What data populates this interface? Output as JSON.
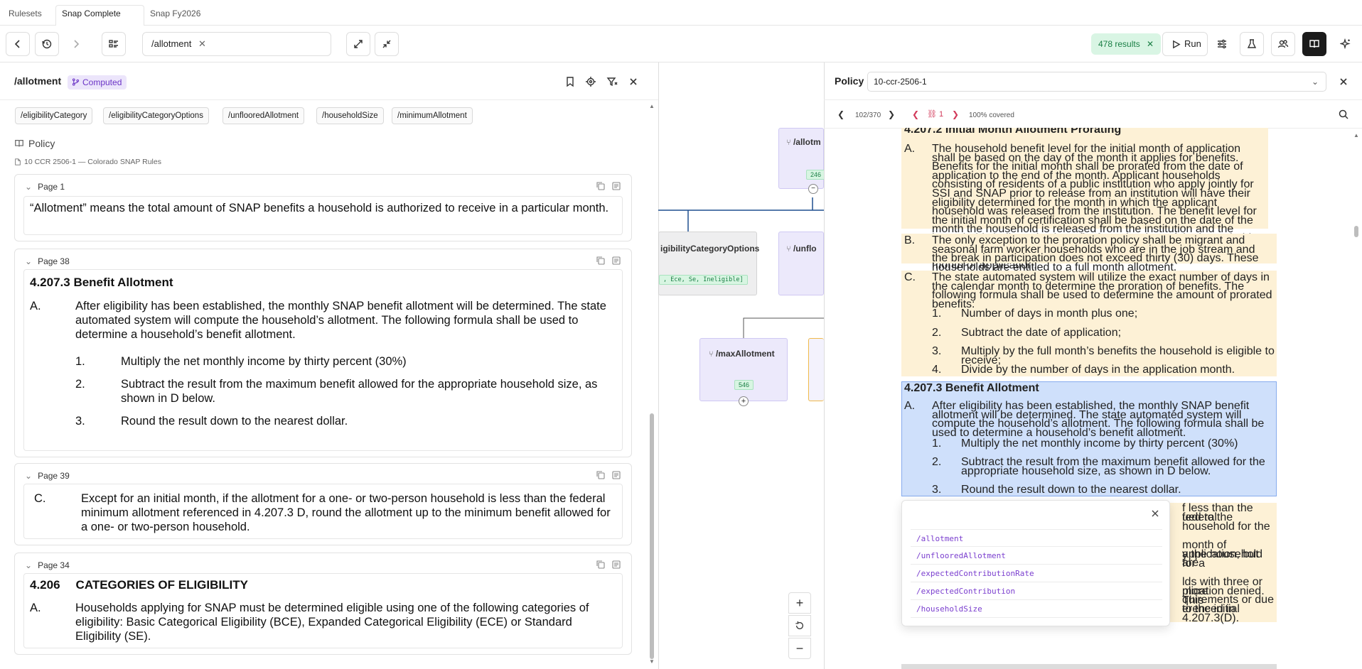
{
  "tabs": [
    {
      "label": "Rulesets"
    },
    {
      "label": "Snap Complete"
    },
    {
      "label": "Snap Fy2026"
    }
  ],
  "toolbar": {
    "path_value": "/allotment",
    "results_label": "478 results",
    "run_label": "Run"
  },
  "left": {
    "title": "/allotment",
    "computed_label": "Computed",
    "chips": [
      "/eligibilityCategory",
      "/eligibilityCategoryOptions",
      "/unflooredAllotment",
      "/householdSize",
      "/minimumAllotment"
    ],
    "policy_heading": "Policy",
    "source_label": "10 CCR 2506-1 — Colorado SNAP Rules",
    "cards": [
      {
        "page": "Page 1",
        "text": "“Allotment” means the total amount of SNAP benefits a household is authorized to receive in a particular month."
      },
      {
        "page": "Page 38",
        "heading": "4.207.3 Benefit Allotment",
        "letter": "A.",
        "para": "After eligibility has been established, the monthly SNAP benefit allotment will be determined. The state automated system will compute the household’s allotment. The following formula shall be used to determine a household’s benefit allotment.",
        "items": [
          {
            "num": "1.",
            "text": "Multiply the net monthly income by thirty percent (30%)"
          },
          {
            "num": "2.",
            "text": "Subtract the result from the maximum benefit allowed for the appropriate household size, as shown in D below."
          },
          {
            "num": "3.",
            "text": "Round the result down to the nearest dollar."
          }
        ]
      },
      {
        "page": "Page 39",
        "letter": "C.",
        "para": "Except for an initial month, if the allotment for a one- or two-person household is less than the federal minimum allotment referenced in 4.207.3 D, round the allotment up to the minimum benefit allowed for a one- or two-person household."
      },
      {
        "page": "Page 34",
        "num": "4.206",
        "heading": "CATEGORIES OF ELIGIBILITY",
        "letter": "A.",
        "para": "Households applying for SNAP must be determined eligible using one of the following categories of eligibility: Basic Categorical Eligibility (BCE), Expanded Categorical Eligibility (ECE) or Standard Eligibility (SE)."
      }
    ]
  },
  "graph": {
    "node_allotment": "/allotm",
    "node_allotment_badge": "246",
    "node_options": "igibilityCategoryOptions",
    "node_options_badge": ", Ece, Se, Ineligible]",
    "node_unfloored": "/unflo",
    "node_max": "/maxAllotment",
    "node_max_badge": "546"
  },
  "policy": {
    "label": "Policy",
    "select_value": "10-ccr-2506-1",
    "page_counter": "102/370",
    "match_counter": "1",
    "coverage": "100% covered",
    "doc": {
      "top_heading": "4.207.2 Initial Month Allotment Prorating",
      "a_letter": "A.",
      "a_text": "The household benefit level for the initial month of application shall be based on the day of the month it applies for benefits. Benefits for the initial month shall be prorated from the date of application to the end of the month. Applicant households consisting of residents of a public institution who apply jointly for SSI and SNAP prior to release from an institution will have their eligibility determined for the month in which the applicant household was released from the institution. The benefit level for the initial month of certification shall be based on the date of the month the household is released from the institution and the household shall receive benefits from the date of the household’s release through the end of the month. Eligible households are entitled to a full month allotment for all months except an initial month of application.",
      "b_letter": "B.",
      "b_text": "The only exception to the proration policy shall be migrant and seasonal farm worker households who are in the job stream and the break in participation does not exceed thirty (30) days. These households are entitled to a full month allotment.",
      "c_letter": "C.",
      "c_text": "The state automated system will utilize the exact number of days in the calendar month to determine the proration of benefits. The following formula shall be used to determine the amount of prorated benefits:",
      "c_items": [
        {
          "num": "1.",
          "text": "Number of days in month plus one;"
        },
        {
          "num": "2.",
          "text": "Subtract the date of application;"
        },
        {
          "num": "3.",
          "text": "Multiply by the full month’s benefits the household is eligible to receive;"
        },
        {
          "num": "4.",
          "text": "Divide by the number of days in the application month."
        }
      ],
      "sel_heading": "4.207.3 Benefit Allotment",
      "sel_letter": "A.",
      "sel_text": "After eligibility has been established, the monthly SNAP benefit allotment will be determined. The state automated system will compute the household’s allotment. The following formula shall be used to determine a household’s benefit allotment.",
      "sel_items": [
        {
          "num": "1.",
          "text": "Multiply the net monthly income by thirty percent (30%)"
        },
        {
          "num": "2.",
          "text": "Subtract the result from the maximum benefit allowed for the appropriate household size, as shown in D below."
        },
        {
          "num": "3.",
          "text": "Round the result down to the nearest dollar."
        }
      ],
      "frag1": "f less than the federal",
      "frag2": "ued to the household for the",
      "frag3": "month of application, but are",
      "frag4": "y the household for a",
      "frag5": "lds with three or more",
      "frag6": "plication denied. This",
      "frag7": "quirements or due to the initial",
      "frag8": "erenced in 4.207.3(D)."
    },
    "popup_links": [
      "/allotment",
      "/unflooredAllotment",
      "/expectedContributionRate",
      "/expectedContribution",
      "/householdSize"
    ]
  }
}
